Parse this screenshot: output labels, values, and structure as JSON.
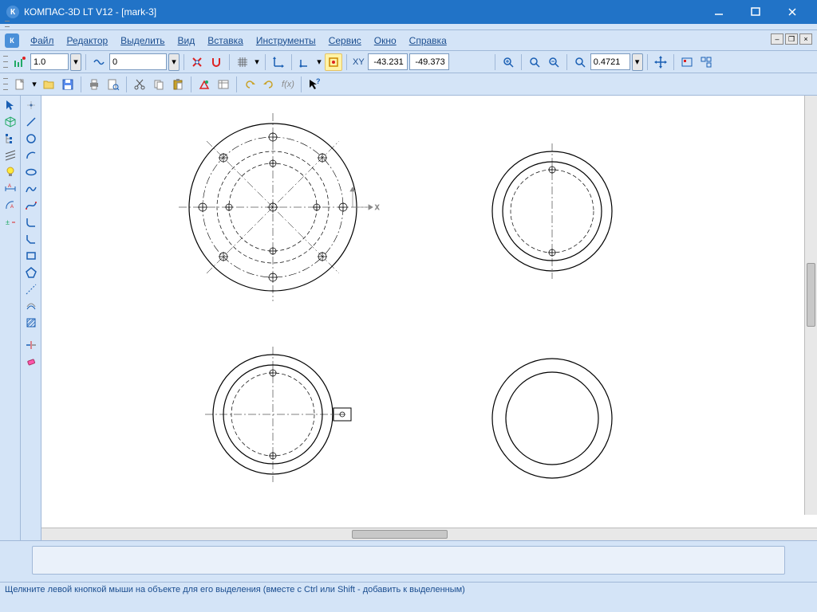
{
  "window": {
    "title": "КОМПАС-3D LT V12 - [mark-3]"
  },
  "menu": {
    "file": "Файл",
    "editor": "Редактор",
    "select": "Выделить",
    "view": "Вид",
    "insert": "Вставка",
    "tools": "Инструменты",
    "service": "Сервис",
    "window": "Окно",
    "help": "Справка"
  },
  "toolbar1": {
    "step_value": "1.0",
    "style_value": "0",
    "coord_x": "-43.231",
    "coord_y": "-49.373",
    "zoom_value": "0.4721",
    "xy_label": "XY"
  },
  "status": {
    "text": "Щелкните левой кнопкой мыши на объекте для его выделения (вместе с Ctrl или Shift - добавить к выделенным)"
  }
}
